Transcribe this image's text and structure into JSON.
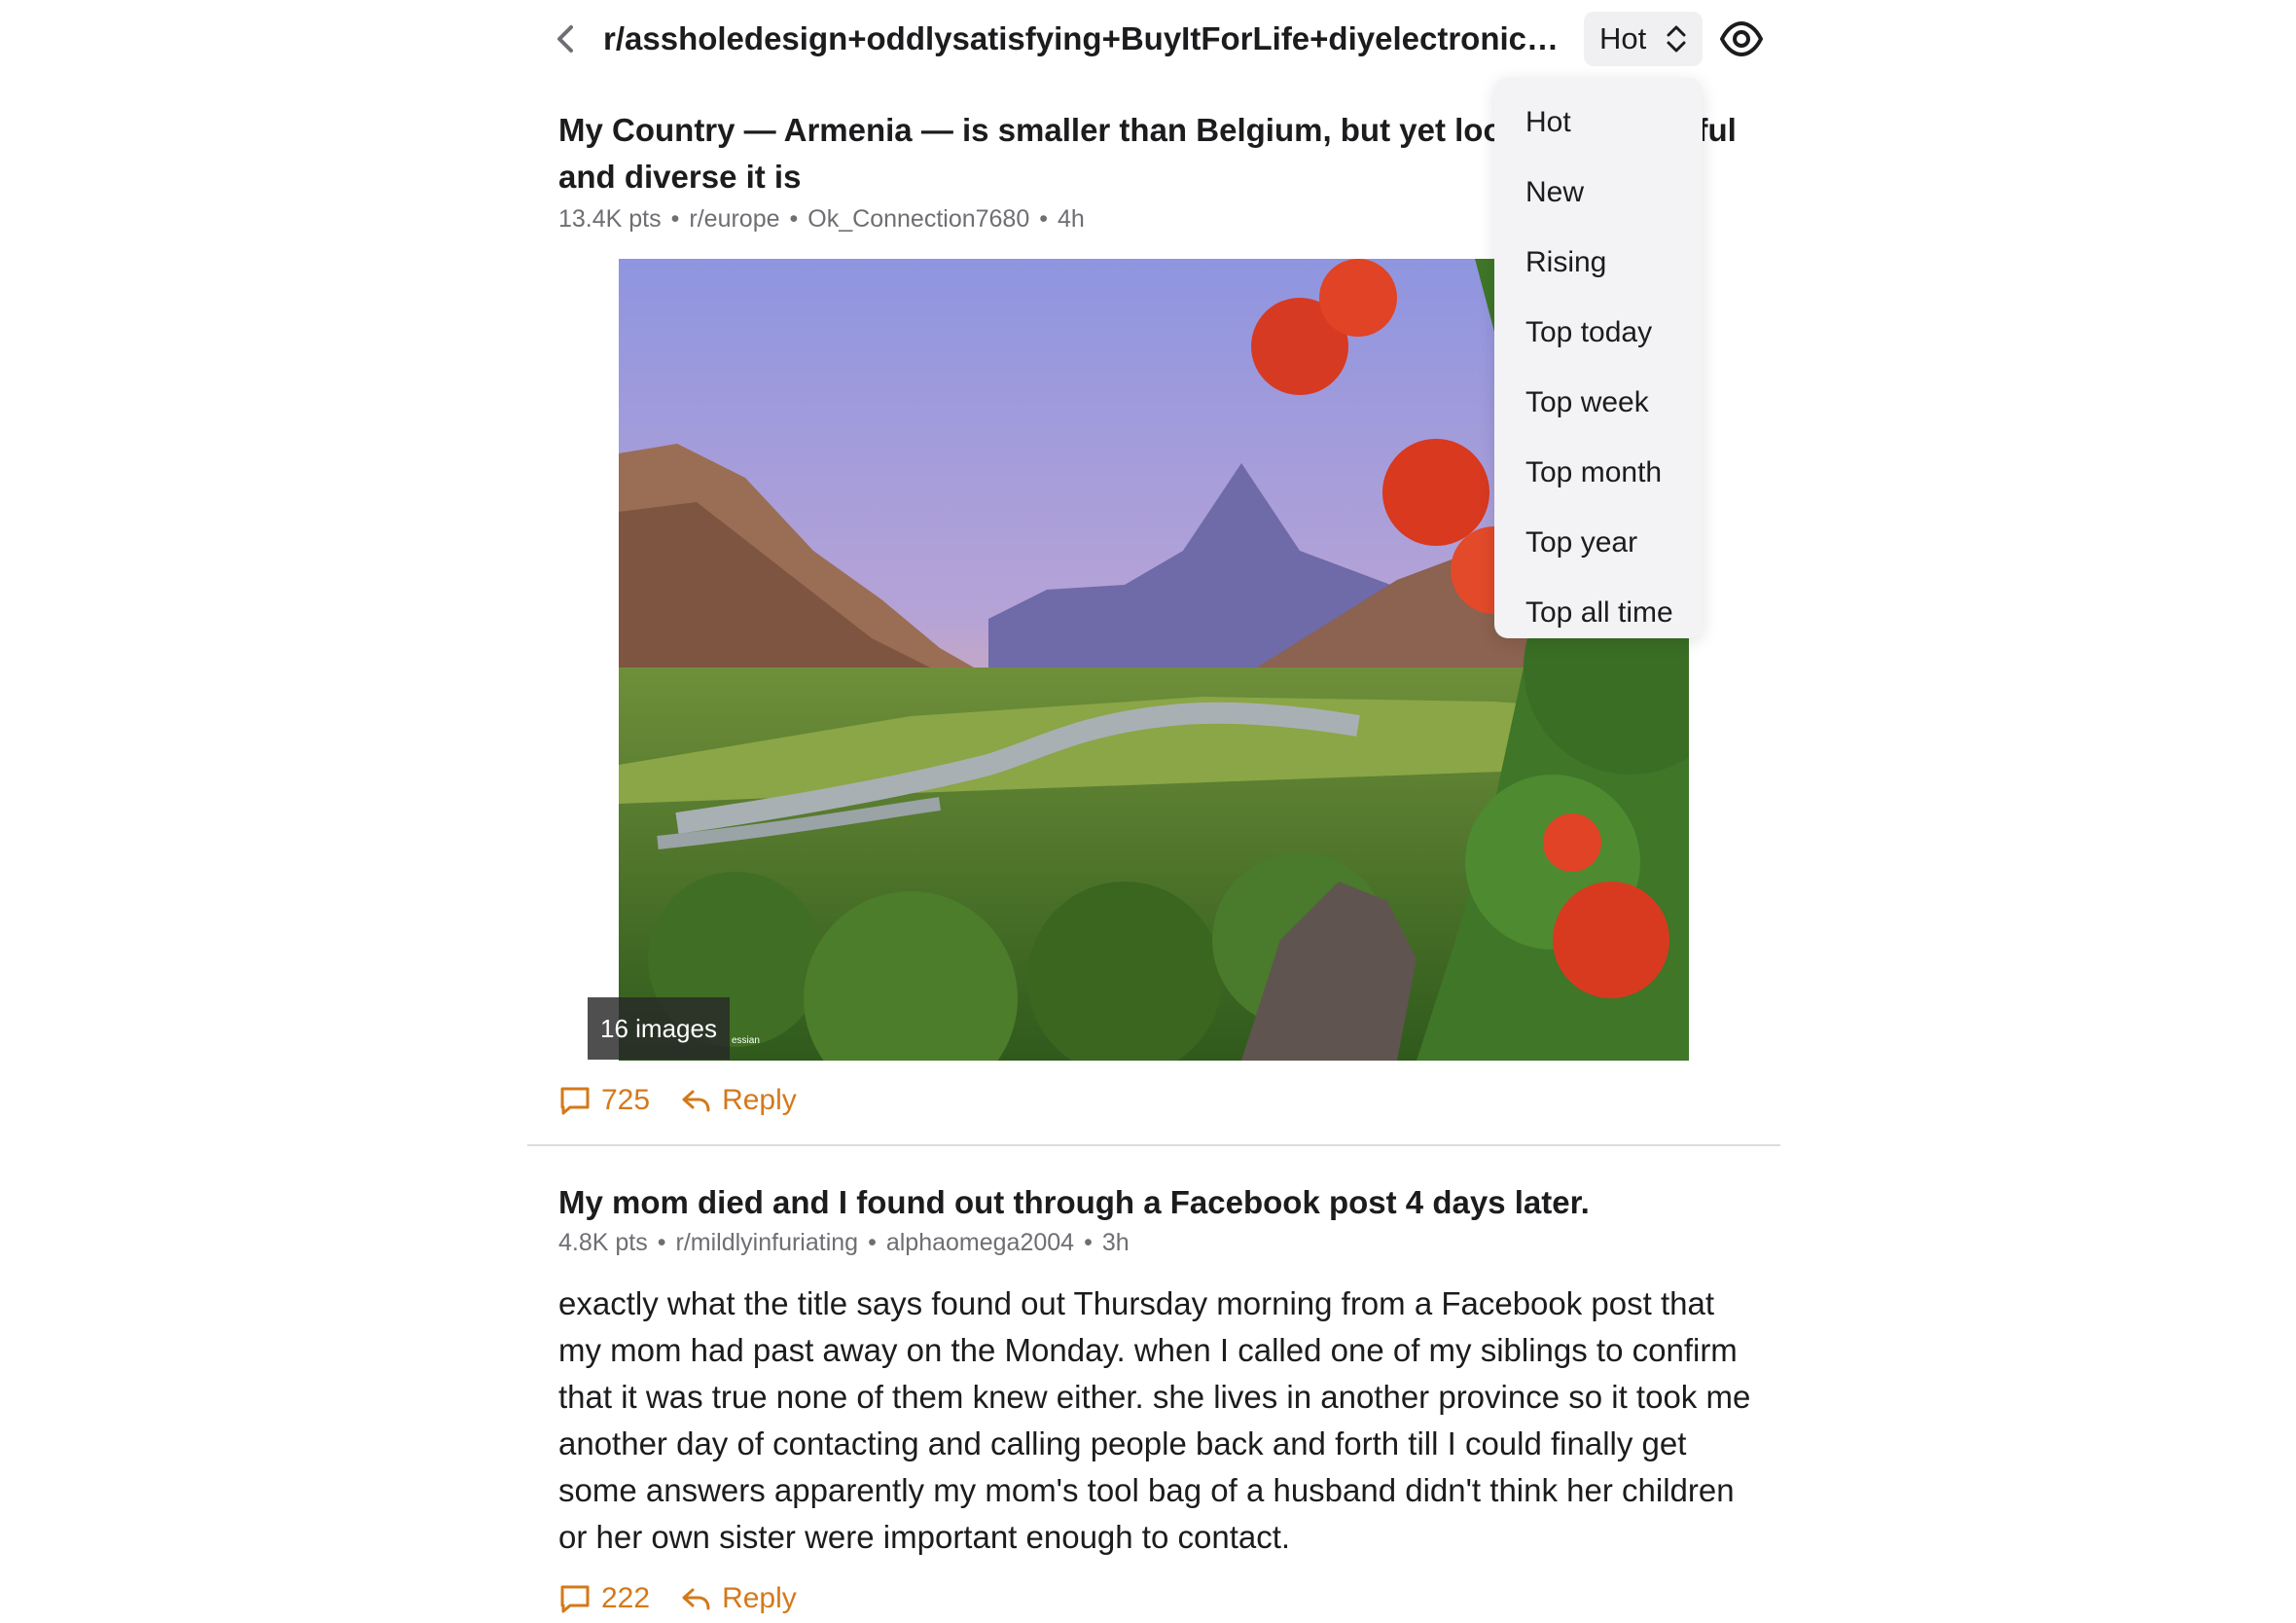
{
  "header": {
    "back_icon": "chevron-left-icon",
    "title": "r/assholedesign+oddlysatisfying+BuyItForLife+diyelectronics+...",
    "sort_label": "Hot",
    "sort_icon": "chevron-up-down-icon",
    "view_icon": "eye-icon"
  },
  "sort_menu": {
    "items": [
      "Hot",
      "New",
      "Rising",
      "Top today",
      "Top week",
      "Top month",
      "Top year",
      "Top all time"
    ]
  },
  "posts": [
    {
      "title": "My Country — Armenia — is smaller than Belgium, but yet look how beautiful and diverse it is",
      "points": "13.4K pts",
      "subreddit": "r/europe",
      "author": "Ok_Connection7680",
      "age": "4h",
      "image_badge": "16 images",
      "image_watermark": "essian",
      "comments": "725",
      "reply_label": "Reply"
    },
    {
      "title": "My mom died and I found out through a Facebook post 4 days later.",
      "points": "4.8K pts",
      "subreddit": "r/mildlyinfuriating",
      "author": "alphaomega2004",
      "age": "3h",
      "body": "exactly what the title says found out Thursday morning from a Facebook post that my mom had past away on the Monday. when I called one of my siblings to confirm that it was true none of them knew either. she lives in another province so it took me another day of contacting and calling people back and forth till I could finally get some answers apparently my mom's tool bag of a husband didn't think her children or her own sister were important enough to contact.",
      "comments": "222",
      "reply_label": "Reply"
    }
  ],
  "colors": {
    "accent": "#d4791a",
    "text": "#1c1c1e",
    "meta": "#6e6e73",
    "menu_bg": "#f3f3f5"
  }
}
